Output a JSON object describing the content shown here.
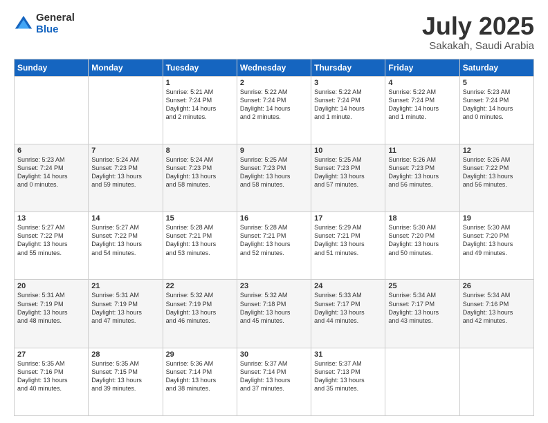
{
  "logo": {
    "general": "General",
    "blue": "Blue"
  },
  "header": {
    "month": "July 2025",
    "location": "Sakakah, Saudi Arabia"
  },
  "days": [
    "Sunday",
    "Monday",
    "Tuesday",
    "Wednesday",
    "Thursday",
    "Friday",
    "Saturday"
  ],
  "weeks": [
    [
      {
        "day": "",
        "content": ""
      },
      {
        "day": "",
        "content": ""
      },
      {
        "day": "1",
        "content": "Sunrise: 5:21 AM\nSunset: 7:24 PM\nDaylight: 14 hours\nand 2 minutes."
      },
      {
        "day": "2",
        "content": "Sunrise: 5:22 AM\nSunset: 7:24 PM\nDaylight: 14 hours\nand 2 minutes."
      },
      {
        "day": "3",
        "content": "Sunrise: 5:22 AM\nSunset: 7:24 PM\nDaylight: 14 hours\nand 1 minute."
      },
      {
        "day": "4",
        "content": "Sunrise: 5:22 AM\nSunset: 7:24 PM\nDaylight: 14 hours\nand 1 minute."
      },
      {
        "day": "5",
        "content": "Sunrise: 5:23 AM\nSunset: 7:24 PM\nDaylight: 14 hours\nand 0 minutes."
      }
    ],
    [
      {
        "day": "6",
        "content": "Sunrise: 5:23 AM\nSunset: 7:24 PM\nDaylight: 14 hours\nand 0 minutes."
      },
      {
        "day": "7",
        "content": "Sunrise: 5:24 AM\nSunset: 7:23 PM\nDaylight: 13 hours\nand 59 minutes."
      },
      {
        "day": "8",
        "content": "Sunrise: 5:24 AM\nSunset: 7:23 PM\nDaylight: 13 hours\nand 58 minutes."
      },
      {
        "day": "9",
        "content": "Sunrise: 5:25 AM\nSunset: 7:23 PM\nDaylight: 13 hours\nand 58 minutes."
      },
      {
        "day": "10",
        "content": "Sunrise: 5:25 AM\nSunset: 7:23 PM\nDaylight: 13 hours\nand 57 minutes."
      },
      {
        "day": "11",
        "content": "Sunrise: 5:26 AM\nSunset: 7:23 PM\nDaylight: 13 hours\nand 56 minutes."
      },
      {
        "day": "12",
        "content": "Sunrise: 5:26 AM\nSunset: 7:22 PM\nDaylight: 13 hours\nand 56 minutes."
      }
    ],
    [
      {
        "day": "13",
        "content": "Sunrise: 5:27 AM\nSunset: 7:22 PM\nDaylight: 13 hours\nand 55 minutes."
      },
      {
        "day": "14",
        "content": "Sunrise: 5:27 AM\nSunset: 7:22 PM\nDaylight: 13 hours\nand 54 minutes."
      },
      {
        "day": "15",
        "content": "Sunrise: 5:28 AM\nSunset: 7:21 PM\nDaylight: 13 hours\nand 53 minutes."
      },
      {
        "day": "16",
        "content": "Sunrise: 5:28 AM\nSunset: 7:21 PM\nDaylight: 13 hours\nand 52 minutes."
      },
      {
        "day": "17",
        "content": "Sunrise: 5:29 AM\nSunset: 7:21 PM\nDaylight: 13 hours\nand 51 minutes."
      },
      {
        "day": "18",
        "content": "Sunrise: 5:30 AM\nSunset: 7:20 PM\nDaylight: 13 hours\nand 50 minutes."
      },
      {
        "day": "19",
        "content": "Sunrise: 5:30 AM\nSunset: 7:20 PM\nDaylight: 13 hours\nand 49 minutes."
      }
    ],
    [
      {
        "day": "20",
        "content": "Sunrise: 5:31 AM\nSunset: 7:19 PM\nDaylight: 13 hours\nand 48 minutes."
      },
      {
        "day": "21",
        "content": "Sunrise: 5:31 AM\nSunset: 7:19 PM\nDaylight: 13 hours\nand 47 minutes."
      },
      {
        "day": "22",
        "content": "Sunrise: 5:32 AM\nSunset: 7:19 PM\nDaylight: 13 hours\nand 46 minutes."
      },
      {
        "day": "23",
        "content": "Sunrise: 5:32 AM\nSunset: 7:18 PM\nDaylight: 13 hours\nand 45 minutes."
      },
      {
        "day": "24",
        "content": "Sunrise: 5:33 AM\nSunset: 7:17 PM\nDaylight: 13 hours\nand 44 minutes."
      },
      {
        "day": "25",
        "content": "Sunrise: 5:34 AM\nSunset: 7:17 PM\nDaylight: 13 hours\nand 43 minutes."
      },
      {
        "day": "26",
        "content": "Sunrise: 5:34 AM\nSunset: 7:16 PM\nDaylight: 13 hours\nand 42 minutes."
      }
    ],
    [
      {
        "day": "27",
        "content": "Sunrise: 5:35 AM\nSunset: 7:16 PM\nDaylight: 13 hours\nand 40 minutes."
      },
      {
        "day": "28",
        "content": "Sunrise: 5:35 AM\nSunset: 7:15 PM\nDaylight: 13 hours\nand 39 minutes."
      },
      {
        "day": "29",
        "content": "Sunrise: 5:36 AM\nSunset: 7:14 PM\nDaylight: 13 hours\nand 38 minutes."
      },
      {
        "day": "30",
        "content": "Sunrise: 5:37 AM\nSunset: 7:14 PM\nDaylight: 13 hours\nand 37 minutes."
      },
      {
        "day": "31",
        "content": "Sunrise: 5:37 AM\nSunset: 7:13 PM\nDaylight: 13 hours\nand 35 minutes."
      },
      {
        "day": "",
        "content": ""
      },
      {
        "day": "",
        "content": ""
      }
    ]
  ]
}
